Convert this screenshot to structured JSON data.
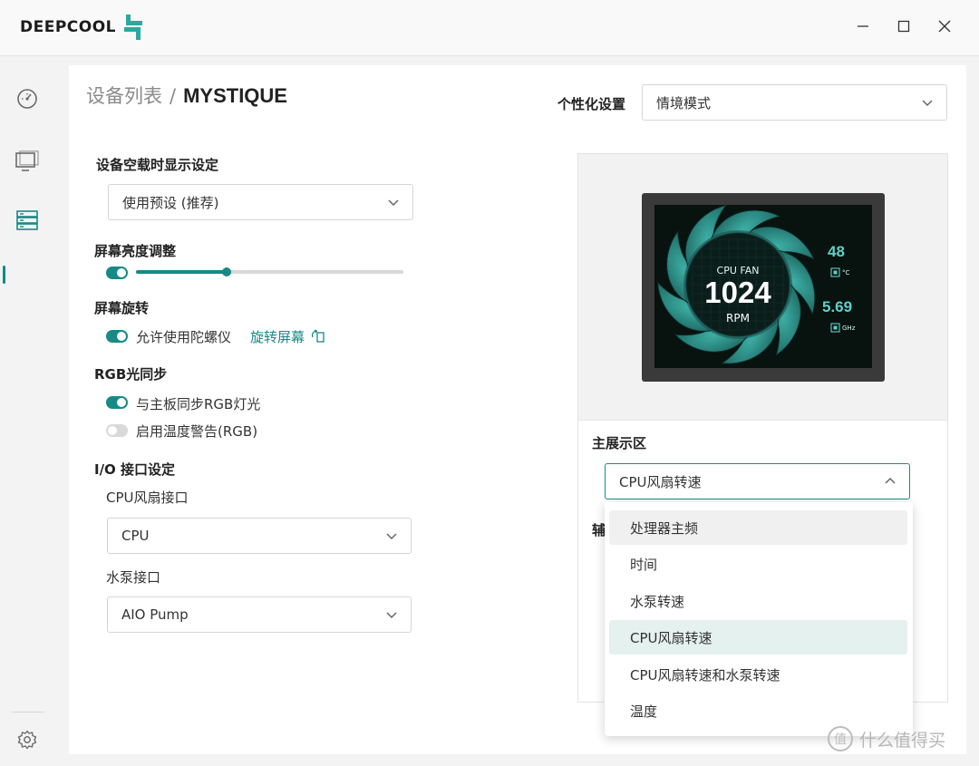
{
  "app": {
    "brand": "DEEPCOOL",
    "window_controls": [
      "minimize-icon",
      "maximize-icon",
      "close-icon"
    ]
  },
  "nav": {
    "items": [
      "dashboard-gauge-icon",
      "monitor-icon",
      "device-list-icon"
    ],
    "active": "device-list-icon",
    "bottom": "settings-gear-icon"
  },
  "breadcrumb": {
    "parent": "设备列表",
    "separator": "/",
    "current": "MYSTIQUE"
  },
  "personalization": {
    "label": "个性化设置",
    "value": "情境模式"
  },
  "idle_display": {
    "label": "设备空载时显示设定",
    "value": "使用预设 (推荐)"
  },
  "brightness": {
    "label": "屏幕亮度调整",
    "enabled": true,
    "level_fraction": 0.34
  },
  "rotation": {
    "label": "屏幕旋转",
    "gyro_label": "允许使用陀螺仪",
    "gyro_enabled": true,
    "rotate_link": "旋转屏幕"
  },
  "rgb_sync": {
    "label": "RGB光同步",
    "motherboard_label": "与主板同步RGB灯光",
    "motherboard_enabled": true,
    "temp_warning_label": "启用温度警告(RGB)",
    "temp_warning_enabled": false
  },
  "io": {
    "label": "I/O 接口设定",
    "cpu_fan_label": "CPU风扇接口",
    "cpu_fan_value": "CPU",
    "pump_label": "水泵接口",
    "pump_value": "AIO Pump"
  },
  "preview": {
    "center_title": "CPU FAN",
    "center_value": "1024",
    "center_unit": "RPM",
    "temp_value": "48",
    "temp_unit": "°C",
    "freq_value": "5.69",
    "freq_unit": "GHz",
    "accent": "#5fd0c8"
  },
  "main_display": {
    "label": "主展示区",
    "value": "CPU风扇转速",
    "secondary_label_partial": "辅"
  },
  "dropdown": {
    "options": [
      "处理器主频",
      "时间",
      "水泵转速",
      "CPU风扇转速",
      "CPU风扇转速和水泵转速",
      "温度"
    ],
    "hovered": "处理器主频",
    "selected": "CPU风扇转速"
  },
  "watermark": {
    "text": "什么值得买",
    "icon": "zhi-badge-icon"
  },
  "colors": {
    "accent": "#178a86",
    "background": "#f3f3f3"
  }
}
